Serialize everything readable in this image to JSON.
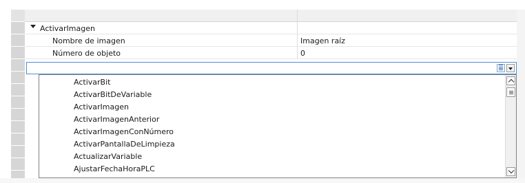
{
  "tree": {
    "section_label": "ActivarImagen",
    "properties": [
      {
        "name": "Nombre de imagen",
        "value": "Imagen raíz"
      },
      {
        "name": "Número de objeto",
        "value": "0"
      }
    ]
  },
  "editor": {
    "value": "",
    "list_icon": "list-icon",
    "dropdown_icon": "chevron-down-icon"
  },
  "dropdown": {
    "options": [
      "ActivarBit",
      "ActivarBitDeVariable",
      "ActivarImagen",
      "ActivarImagenAnterior",
      "ActivarImagenConNúmero",
      "ActivarPantallaDeLimpieza",
      "ActualizarVariable",
      "AjustarFechaHoraPLC"
    ]
  },
  "colors": {
    "gutter": "#d6d6d6",
    "editor_border": "#4a90d9",
    "dropdown_border": "#808080"
  }
}
